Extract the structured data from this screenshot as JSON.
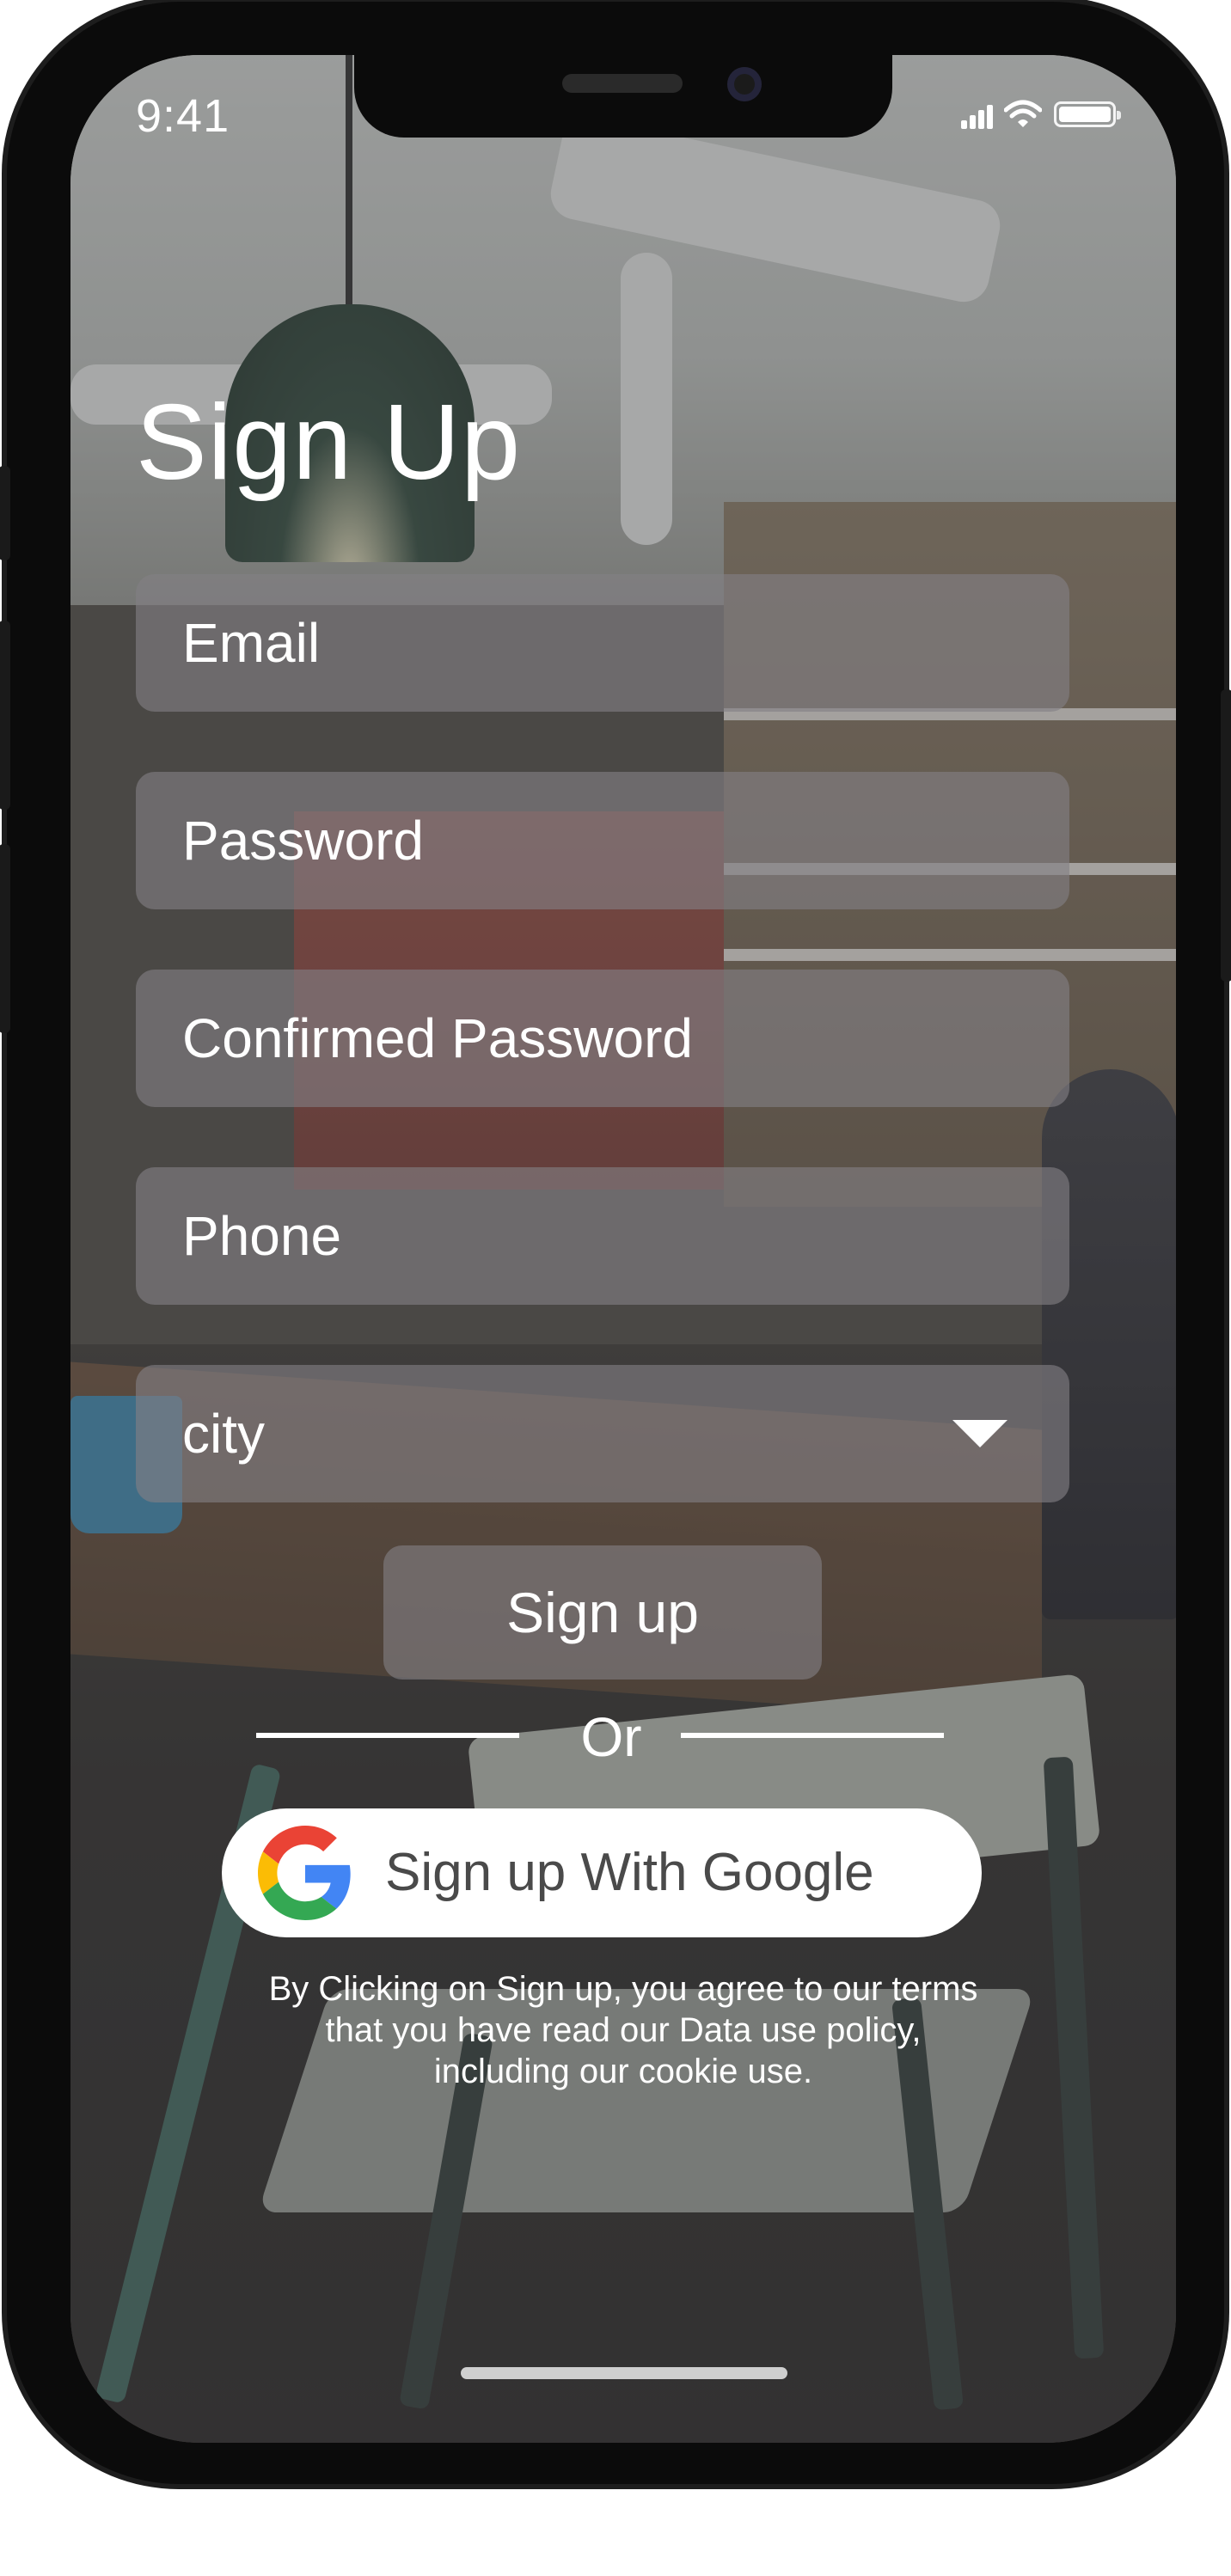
{
  "status_bar": {
    "time": "9:41"
  },
  "page": {
    "title": "Sign Up"
  },
  "form": {
    "email_placeholder": "Email",
    "password_placeholder": "Password",
    "confirm_password_placeholder": "Confirmed Password",
    "phone_placeholder": "Phone",
    "city_selected": "city",
    "signup_label": "Sign up",
    "divider_label": "Or",
    "google_label": "Sign up With Google"
  },
  "terms": {
    "line1": "By Clicking on Sign up, you agree to our terms",
    "line2": "that you have read our Data use policy,",
    "line3": "including our cookie use."
  },
  "icons": {
    "signal": "cellular-signal-icon",
    "wifi": "wifi-icon",
    "battery": "battery-icon",
    "dropdown": "chevron-down-icon",
    "google": "google-logo-icon"
  },
  "colors": {
    "text": "#ffffff",
    "field_bg": "rgba(130,128,132,0.62)",
    "google_blue": "#4285F4",
    "google_red": "#EA4335",
    "google_yellow": "#FBBC05",
    "google_green": "#34A853"
  }
}
